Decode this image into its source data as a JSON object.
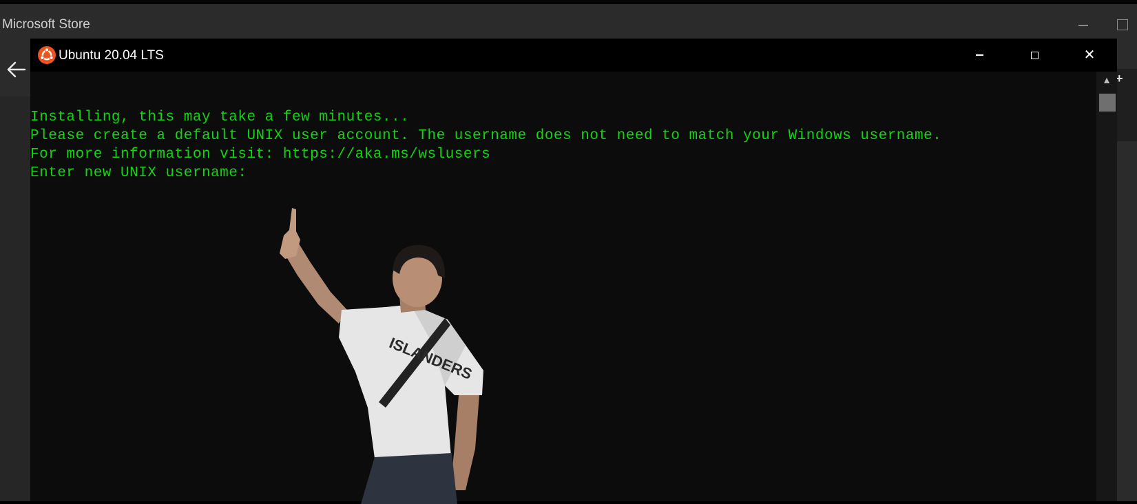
{
  "store": {
    "title": "Microsoft Store",
    "minimize_icon": "minimize-icon",
    "maximize_icon": "maximize-icon",
    "back_icon": "back-arrow-icon",
    "plus_glyph": "+"
  },
  "terminal": {
    "title": "Ubuntu 20.04 LTS",
    "icon": "ubuntu-logo-icon",
    "controls": {
      "minimize_icon": "minimize-icon",
      "maximize_icon": "maximize-icon",
      "close_icon": "close-icon",
      "close_glyph": "✕"
    },
    "lines": [
      "Installing, this may take a few minutes...",
      "Please create a default UNIX user account. The username does not need to match your Windows username.",
      "For more information visit: https://aka.ms/wslusers",
      "Enter new UNIX username:"
    ],
    "scroll_up_glyph": "▲"
  },
  "overlay": {
    "shirt_text": "ISLANDERS"
  },
  "colors": {
    "terminal_text": "#13d413",
    "terminal_bg": "#0c0c0c",
    "store_bg": "#2b2b2b",
    "ubuntu_orange": "#e95420"
  }
}
